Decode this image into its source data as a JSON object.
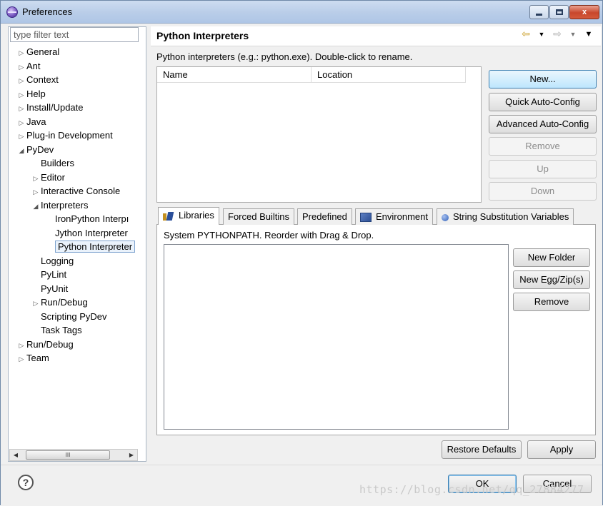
{
  "window": {
    "title": "Preferences",
    "controls": {
      "minimize": "",
      "maximize": "",
      "close": "x"
    }
  },
  "sidebar": {
    "filter_placeholder": "type filter text",
    "items": [
      {
        "label": "General",
        "expander": "collapsed"
      },
      {
        "label": "Ant",
        "expander": "collapsed"
      },
      {
        "label": "Context",
        "expander": "collapsed"
      },
      {
        "label": "Help",
        "expander": "collapsed"
      },
      {
        "label": "Install/Update",
        "expander": "collapsed"
      },
      {
        "label": "Java",
        "expander": "collapsed"
      },
      {
        "label": "Plug-in Development",
        "expander": "collapsed"
      },
      {
        "label": "PyDev",
        "expander": "expanded"
      },
      {
        "label": "Builders",
        "expander": "none"
      },
      {
        "label": "Editor",
        "expander": "collapsed"
      },
      {
        "label": "Interactive Console",
        "expander": "collapsed"
      },
      {
        "label": "Interpreters",
        "expander": "expanded"
      },
      {
        "label": "IronPython Interpı",
        "expander": "none"
      },
      {
        "label": "Jython Interpreter",
        "expander": "none"
      },
      {
        "label": "Python Interpreter",
        "expander": "none",
        "selected": true
      },
      {
        "label": "Logging",
        "expander": "none"
      },
      {
        "label": "PyLint",
        "expander": "none"
      },
      {
        "label": "PyUnit",
        "expander": "none"
      },
      {
        "label": "Run/Debug",
        "expander": "collapsed"
      },
      {
        "label": "Scripting PyDev",
        "expander": "none"
      },
      {
        "label": "Task Tags",
        "expander": "none"
      },
      {
        "label": "Run/Debug",
        "expander": "collapsed"
      },
      {
        "label": "Team",
        "expander": "collapsed"
      }
    ],
    "scroll_thumb": "III"
  },
  "page": {
    "title": "Python Interpreters",
    "description": "Python interpreters (e.g.: python.exe).   Double-click to rename.",
    "table_columns": [
      "Name",
      "Location"
    ],
    "buttons": {
      "new": "New...",
      "quick_auto_config": "Quick Auto-Config",
      "advanced_auto_config": "Advanced Auto-Config",
      "remove": "Remove",
      "up": "Up",
      "down": "Down"
    },
    "tabs": [
      {
        "label": "Libraries",
        "icon": "libraries-icon",
        "active": true
      },
      {
        "label": "Forced Builtins",
        "icon": "",
        "active": false
      },
      {
        "label": "Predefined",
        "icon": "",
        "active": false
      },
      {
        "label": "Environment",
        "icon": "environment-icon",
        "active": false
      },
      {
        "label": "String Substitution Variables",
        "icon": "variables-icon",
        "active": false
      }
    ],
    "libraries": {
      "label": "System PYTHONPATH.   Reorder with Drag & Drop.",
      "buttons": {
        "new_folder": "New Folder",
        "new_egg": "New Egg/Zip(s)",
        "remove": "Remove"
      }
    },
    "restore_defaults": "Restore Defaults",
    "apply": "Apply"
  },
  "footer": {
    "help": "?",
    "ok": "OK",
    "cancel": "Cancel",
    "watermark": "https://blog.csdn.net/qq_27884277"
  },
  "colors": {
    "titlebar": "#b9cde8",
    "close_button": "#c8472c",
    "selection_border": "#7da2ce",
    "default_button": "#3c7fb1"
  }
}
